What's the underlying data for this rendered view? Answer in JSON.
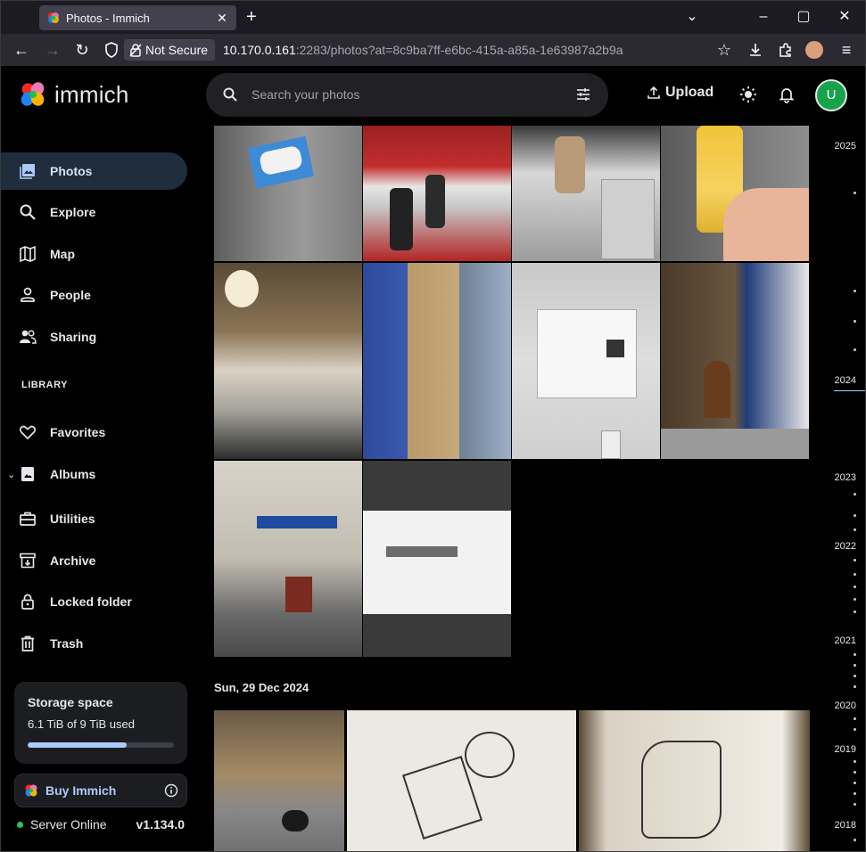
{
  "browser": {
    "tab_title": "Photos - Immich",
    "security_label": "Not Secure",
    "url_host": "10.170.0.161",
    "url_rest": ":2283/photos?at=8c9ba7ff-e6bc-415a-a85a-1e63987a2b9a"
  },
  "header": {
    "app_name": "immich",
    "search_placeholder": "Search your photos",
    "upload_label": "Upload",
    "avatar_initial": "U"
  },
  "sidebar": {
    "items": [
      {
        "label": "Photos",
        "icon": "photos-icon",
        "active": true
      },
      {
        "label": "Explore",
        "icon": "search-icon"
      },
      {
        "label": "Map",
        "icon": "map-icon"
      },
      {
        "label": "People",
        "icon": "people-icon"
      },
      {
        "label": "Sharing",
        "icon": "sharing-icon"
      }
    ],
    "library_heading": "LIBRARY",
    "library_items": [
      {
        "label": "Favorites",
        "icon": "heart-icon"
      },
      {
        "label": "Albums",
        "icon": "albums-icon"
      },
      {
        "label": "Utilities",
        "icon": "toolbox-icon"
      },
      {
        "label": "Archive",
        "icon": "archive-icon"
      },
      {
        "label": "Locked folder",
        "icon": "lock-icon"
      },
      {
        "label": "Trash",
        "icon": "trash-icon"
      }
    ],
    "storage": {
      "title": "Storage space",
      "used_text": "6.1 TiB of 9 TiB used",
      "used_fraction": 0.678
    },
    "buy_label": "Buy Immich",
    "server_status": "Server Online",
    "version": "v1.134.0"
  },
  "timeline": {
    "section_date": "Sun, 29 Dec 2024",
    "years": [
      "2025",
      "2024",
      "2023",
      "2022",
      "2021",
      "2020",
      "2019",
      "2018"
    ]
  },
  "colors": {
    "accent": "#adcbfa",
    "active_bg": "#1f2d3d",
    "avatar": "#16a34a",
    "online": "#22c55e"
  }
}
